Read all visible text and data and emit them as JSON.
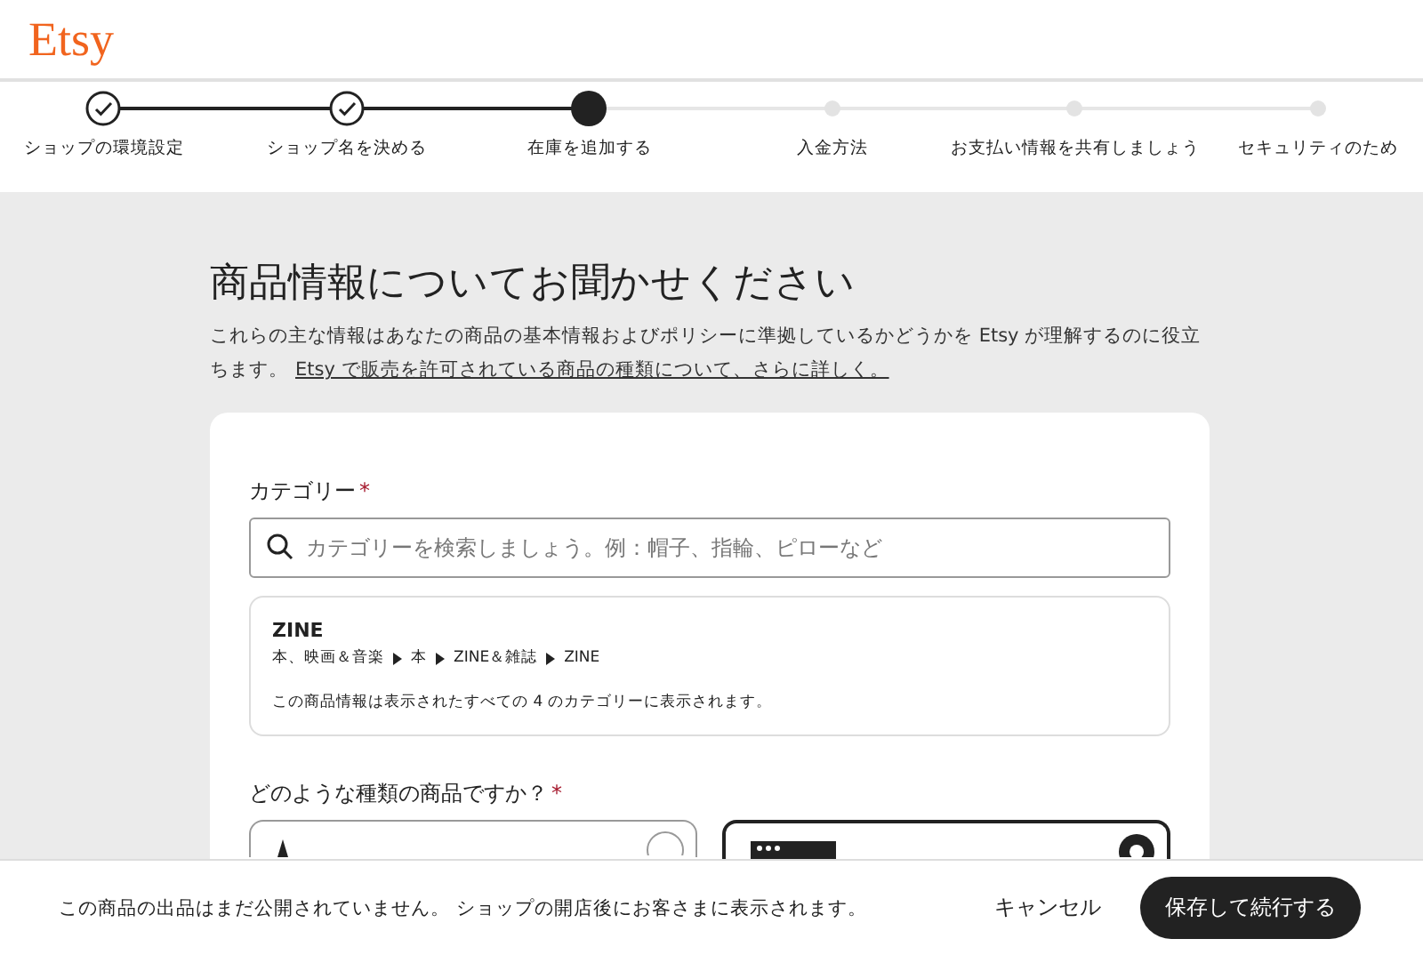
{
  "header": {
    "logo": "Etsy"
  },
  "steps": [
    {
      "label": "ショップの環境設定",
      "completed": true,
      "selected": false
    },
    {
      "label": "ショップ名を決める",
      "completed": true,
      "selected": false
    },
    {
      "label": "在庫を追加する",
      "completed": false,
      "selected": true
    },
    {
      "label": "入金方法",
      "completed": false,
      "selected": false
    },
    {
      "label": "お支払い情報を共有しましょう",
      "completed": false,
      "selected": false
    },
    {
      "label": "セキュリティのため",
      "completed": false,
      "selected": false
    }
  ],
  "intro": {
    "title": "商品情報についてお聞かせください",
    "text": "これらの主な情報はあなたの商品の基本情報およびポリシーに準拠しているかどうかを Etsy が理解するのに役立ちます。",
    "link": "Etsy で販売を許可されている商品の種類について、さらに詳しく。"
  },
  "category": {
    "label": "カテゴリー",
    "required_mark": "*",
    "placeholder": "カテゴリーを検索しましょう。例：帽子、指輪、ピローなど",
    "selected": {
      "name": "ZINE",
      "path": [
        "本、映画＆音楽",
        "本",
        "ZINE＆雑誌",
        "ZINE"
      ],
      "note": "この商品情報は表示されたすべての 4 のカテゴリーに表示されます。"
    }
  },
  "product_type": {
    "label": "どのような種類の商品ですか？",
    "required_mark": "*",
    "options": [
      {
        "kind": "physical",
        "selected": false
      },
      {
        "kind": "digital",
        "selected": true
      }
    ]
  },
  "footer": {
    "notice": "この商品の出品はまだ公開されていません。 ショップの開店後にお客さまに表示されます。",
    "cancel": "キャンセル",
    "save": "保存して続行する"
  }
}
